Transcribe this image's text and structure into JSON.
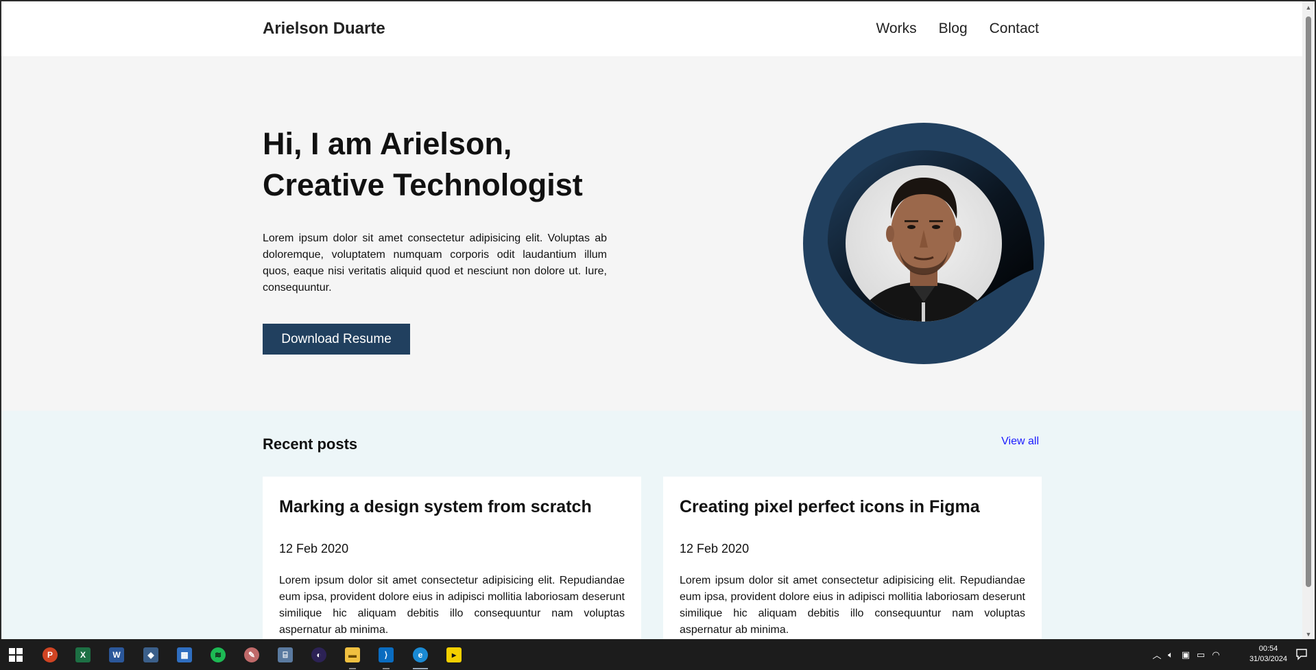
{
  "site": {
    "brand": "Arielson Duarte",
    "nav": [
      "Works",
      "Blog",
      "Contact"
    ]
  },
  "hero": {
    "title_line1": "Hi, I am Arielson,",
    "title_line2": "Creative Technologist",
    "description": "Lorem ipsum dolor sit amet consectetur adipisicing elit. Voluptas ab doloremque, voluptatem numquam corporis odit laudantium illum quos, eaque nisi veritatis aliquid quod et nesciunt non dolore ut. Iure, consequuntur.",
    "button": "Download Resume"
  },
  "posts": {
    "heading": "Recent posts",
    "view_all": "View all",
    "items": [
      {
        "title": "Marking a design system from scratch",
        "date": "12 Feb 2020",
        "excerpt": "Lorem ipsum dolor sit amet consectetur adipisicing elit. Repudiandae eum ipsa, provident dolore eius in adipisci mollitia laboriosam deserunt similique hic aliquam debitis illo consequuntur nam voluptas aspernatur ab minima."
      },
      {
        "title": "Creating pixel perfect icons in Figma",
        "date": "12 Feb 2020",
        "excerpt": "Lorem ipsum dolor sit amet consectetur adipisicing elit. Repudiandae eum ipsa, provident dolore eius in adipisci mollitia laboriosam deserunt similique hic aliquam debitis illo consequuntur nam voluptas aspernatur ab minima."
      }
    ]
  },
  "colors": {
    "accent": "#21405f",
    "hero_bg": "#f5f5f5",
    "posts_bg": "#edf6f8",
    "link": "#1a1aff"
  },
  "taskbar": {
    "apps": [
      "windows-start-icon",
      "powerpoint-icon",
      "excel-icon",
      "word-icon",
      "app-icon",
      "store-icon",
      "spotify-icon",
      "paint-icon",
      "network-app-icon",
      "eclipse-icon",
      "file-explorer-icon",
      "vscode-icon",
      "edge-icon",
      "sticky-app-icon"
    ],
    "time": "00:54",
    "date": "31/03/2024"
  }
}
